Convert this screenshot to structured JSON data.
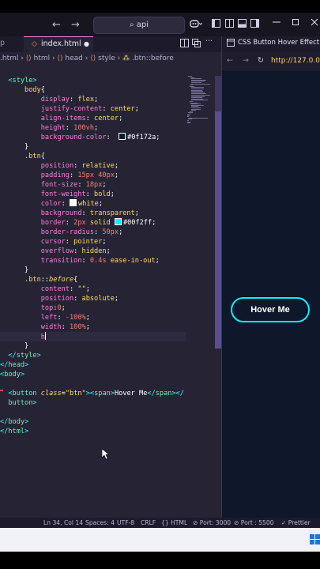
{
  "titlebar": {
    "back_arrow": "←",
    "forward_arrow": "→",
    "search_text": "api",
    "search_glyph": "⌕"
  },
  "tabs": {
    "left_partial": "p",
    "active_label": "index.html",
    "dirty_dot": "●",
    "preview_tab_label": "CSS Button Hover Effect"
  },
  "breadcrumb": {
    "parts": [
      ".html",
      "html",
      "head",
      "style",
      ".btn::before"
    ],
    "sep": "›"
  },
  "code_lines": [
    {
      "indent": "  ",
      "segments": [
        [
          "tagp",
          "<"
        ],
        [
          "tag",
          "style"
        ],
        [
          "tagp",
          ">"
        ]
      ]
    },
    {
      "indent": "      ",
      "segments": [
        [
          "sel",
          "body"
        ],
        [
          "plain",
          "{"
        ]
      ]
    },
    {
      "indent": "          ",
      "segments": [
        [
          "prop",
          "display"
        ],
        [
          "plain",
          ": "
        ],
        [
          "val",
          "flex"
        ],
        [
          "plain",
          ";"
        ]
      ]
    },
    {
      "indent": "          ",
      "segments": [
        [
          "prop",
          "justify-content"
        ],
        [
          "plain",
          ": "
        ],
        [
          "val",
          "center"
        ],
        [
          "plain",
          ";"
        ]
      ]
    },
    {
      "indent": "          ",
      "segments": [
        [
          "prop",
          "align-items"
        ],
        [
          "plain",
          ": "
        ],
        [
          "val",
          "center"
        ],
        [
          "plain",
          ";"
        ]
      ]
    },
    {
      "indent": "          ",
      "segments": [
        [
          "prop",
          "height"
        ],
        [
          "plain",
          ": "
        ],
        [
          "num",
          "100vh"
        ],
        [
          "plain",
          ";"
        ]
      ]
    },
    {
      "indent": "          ",
      "segments": [
        [
          "prop",
          "background-color"
        ],
        [
          "plain",
          ":  "
        ],
        [
          "swatch",
          "#0f172a"
        ],
        [
          "plain",
          "#0f172a"
        ],
        [
          "plain",
          ";"
        ]
      ]
    },
    {
      "indent": "      ",
      "segments": [
        [
          "plain",
          "}"
        ]
      ]
    },
    {
      "indent": "      ",
      "segments": [
        [
          "sel",
          ".btn"
        ],
        [
          "plain",
          "{"
        ]
      ]
    },
    {
      "indent": "          ",
      "segments": [
        [
          "prop",
          "position"
        ],
        [
          "plain",
          ": "
        ],
        [
          "val",
          "relative"
        ],
        [
          "plain",
          ";"
        ]
      ]
    },
    {
      "indent": "          ",
      "segments": [
        [
          "prop",
          "padding"
        ],
        [
          "plain",
          ": "
        ],
        [
          "num",
          "15px"
        ],
        [
          "plain",
          " "
        ],
        [
          "num",
          "40px"
        ],
        [
          "plain",
          ";"
        ]
      ]
    },
    {
      "indent": "          ",
      "segments": [
        [
          "prop",
          "font-size"
        ],
        [
          "plain",
          ": "
        ],
        [
          "num",
          "18px"
        ],
        [
          "plain",
          ";"
        ]
      ]
    },
    {
      "indent": "          ",
      "segments": [
        [
          "prop",
          "font-weight"
        ],
        [
          "plain",
          ": "
        ],
        [
          "val",
          "bold"
        ],
        [
          "plain",
          ";"
        ]
      ]
    },
    {
      "indent": "          ",
      "segments": [
        [
          "prop",
          "color"
        ],
        [
          "plain",
          ": "
        ],
        [
          "swatch",
          "#ffffff"
        ],
        [
          "val",
          "white"
        ],
        [
          "plain",
          ";"
        ]
      ]
    },
    {
      "indent": "          ",
      "segments": [
        [
          "prop",
          "background"
        ],
        [
          "plain",
          ": "
        ],
        [
          "val",
          "transparent"
        ],
        [
          "plain",
          ";"
        ]
      ]
    },
    {
      "indent": "          ",
      "segments": [
        [
          "prop",
          "border"
        ],
        [
          "plain",
          ": "
        ],
        [
          "num",
          "2px"
        ],
        [
          "plain",
          " "
        ],
        [
          "val",
          "solid"
        ],
        [
          "plain",
          " "
        ],
        [
          "swatch",
          "#00f2ff"
        ],
        [
          "plain",
          "#00f2ff"
        ],
        [
          "plain",
          ";"
        ]
      ]
    },
    {
      "indent": "          ",
      "segments": [
        [
          "prop",
          "border-radius"
        ],
        [
          "plain",
          ": "
        ],
        [
          "num",
          "50px"
        ],
        [
          "plain",
          ";"
        ]
      ]
    },
    {
      "indent": "          ",
      "segments": [
        [
          "prop",
          "cursor"
        ],
        [
          "plain",
          ": "
        ],
        [
          "val",
          "pointer"
        ],
        [
          "plain",
          ";"
        ]
      ]
    },
    {
      "indent": "          ",
      "segments": [
        [
          "prop",
          "overflow"
        ],
        [
          "plain",
          ": "
        ],
        [
          "val",
          "hidden"
        ],
        [
          "plain",
          ";"
        ]
      ]
    },
    {
      "indent": "          ",
      "segments": [
        [
          "prop",
          "transition"
        ],
        [
          "plain",
          ": "
        ],
        [
          "num",
          "0.4s"
        ],
        [
          "plain",
          " "
        ],
        [
          "val",
          "ease-in-out"
        ],
        [
          "plain",
          ";"
        ]
      ]
    },
    {
      "indent": "      ",
      "segments": [
        [
          "plain",
          "}"
        ]
      ]
    },
    {
      "indent": "      ",
      "segments": [
        [
          "sel",
          ".btn"
        ],
        [
          "plain",
          "::"
        ],
        [
          "attr",
          "before"
        ],
        [
          "plain",
          "{"
        ]
      ]
    },
    {
      "indent": "          ",
      "segments": [
        [
          "prop",
          "content"
        ],
        [
          "plain",
          ": "
        ],
        [
          "val",
          "\"\""
        ],
        [
          "plain",
          ";"
        ]
      ]
    },
    {
      "indent": "          ",
      "segments": [
        [
          "prop",
          "position"
        ],
        [
          "plain",
          ": "
        ],
        [
          "val",
          "absolute"
        ],
        [
          "plain",
          ";"
        ]
      ]
    },
    {
      "indent": "          ",
      "segments": [
        [
          "prop",
          "top"
        ],
        [
          "plain",
          ":"
        ],
        [
          "num",
          "0"
        ],
        [
          "plain",
          ";"
        ]
      ]
    },
    {
      "indent": "          ",
      "segments": [
        [
          "prop",
          "left"
        ],
        [
          "plain",
          ": "
        ],
        [
          "num",
          "-100%"
        ],
        [
          "plain",
          ";"
        ]
      ]
    },
    {
      "indent": "          ",
      "segments": [
        [
          "prop",
          "width"
        ],
        [
          "plain",
          ": "
        ],
        [
          "num",
          "100%"
        ],
        [
          "plain",
          ";"
        ]
      ]
    },
    {
      "indent": "          ",
      "segments": [
        [
          "prop",
          "h"
        ]
      ],
      "current": true
    },
    {
      "indent": "      ",
      "segments": [
        [
          "plain",
          "}"
        ]
      ]
    },
    {
      "indent": "  ",
      "segments": [
        [
          "tagp",
          "</"
        ],
        [
          "tag",
          "style"
        ],
        [
          "tagp",
          ">"
        ]
      ]
    },
    {
      "indent": "",
      "segments": [
        [
          "tagp",
          "</"
        ],
        [
          "tag",
          "head"
        ],
        [
          "tagp",
          ">"
        ]
      ]
    },
    {
      "indent": "",
      "segments": [
        [
          "tagp",
          "<"
        ],
        [
          "tag",
          "body"
        ],
        [
          "tagp",
          ">"
        ]
      ]
    },
    {
      "indent": "",
      "segments": []
    },
    {
      "indent": "  ",
      "segments": [
        [
          "tagp",
          "<"
        ],
        [
          "tag",
          "button"
        ],
        [
          "plain",
          " "
        ],
        [
          "attr",
          "class"
        ],
        [
          "plain",
          "="
        ],
        [
          "val",
          "\"btn\""
        ],
        [
          "tagp",
          ">"
        ],
        [
          "tagp",
          "<"
        ],
        [
          "tag",
          "span"
        ],
        [
          "tagp",
          ">"
        ],
        [
          "plain",
          "Hover Me"
        ],
        [
          "tagp",
          "</"
        ],
        [
          "tag",
          "span"
        ],
        [
          "tagp",
          "></"
        ]
      ]
    },
    {
      "indent": "  ",
      "segments": [
        [
          "tag",
          "button"
        ],
        [
          "tagp",
          ">"
        ]
      ]
    },
    {
      "indent": "",
      "segments": []
    },
    {
      "indent": "",
      "segments": [
        [
          "tagp",
          "</"
        ],
        [
          "tag",
          "body"
        ],
        [
          "tagp",
          ">"
        ]
      ]
    },
    {
      "indent": "",
      "segments": [
        [
          "tagp",
          "</"
        ],
        [
          "tag",
          "html"
        ],
        [
          "tagp",
          ">"
        ]
      ]
    }
  ],
  "preview": {
    "url": "http://127.0.0.",
    "button_label": "Hover Me",
    "back": "←",
    "forward": "→",
    "reload": "↻"
  },
  "statusbar": {
    "position": "Ln 34, Col 14",
    "spaces": "Spaces: 4",
    "encoding": "UTF-8",
    "eol": "CRLF",
    "language": "{} HTML",
    "port1": "⊘ Port: 3000",
    "port2": "⊘ Port : 5500",
    "prettier": "✓ Prettier"
  },
  "colors": {
    "editor_bg": "#262335",
    "preview_bg": "#0f172a",
    "accent": "#00f2ff"
  }
}
